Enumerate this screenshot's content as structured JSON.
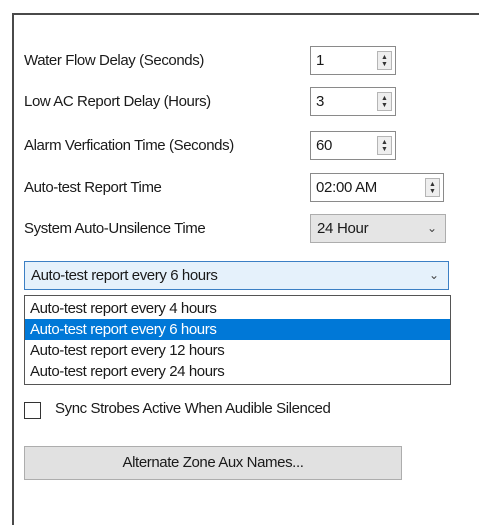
{
  "settings": {
    "water_flow_delay": {
      "label": "Water Flow Delay (Seconds)",
      "value": "1"
    },
    "low_ac_report_delay": {
      "label": "Low AC Report Delay (Hours)",
      "value": "3"
    },
    "alarm_verification_time": {
      "label": "Alarm Verfication Time (Seconds)",
      "value": "60"
    },
    "auto_test_report_time": {
      "label": "Auto-test Report Time",
      "value": "02:00 AM"
    },
    "system_auto_unsilence_time": {
      "label": "System Auto-Unsilence Time",
      "value": "24 Hour"
    }
  },
  "report_interval": {
    "selected": "Auto-test report every 6 hours",
    "options": [
      "Auto-test report every 4 hours",
      "Auto-test report every 6 hours",
      "Auto-test report every 12 hours",
      "Auto-test report every 24 hours"
    ]
  },
  "sync_strobes": {
    "label": "Sync Strobes Active When Audible Silenced",
    "checked": false
  },
  "alternate_zone_button": {
    "label": "Alternate Zone Aux Names..."
  },
  "icons": {
    "spin": "spin-updown-icon",
    "dropdown": "chevron-down-icon"
  }
}
